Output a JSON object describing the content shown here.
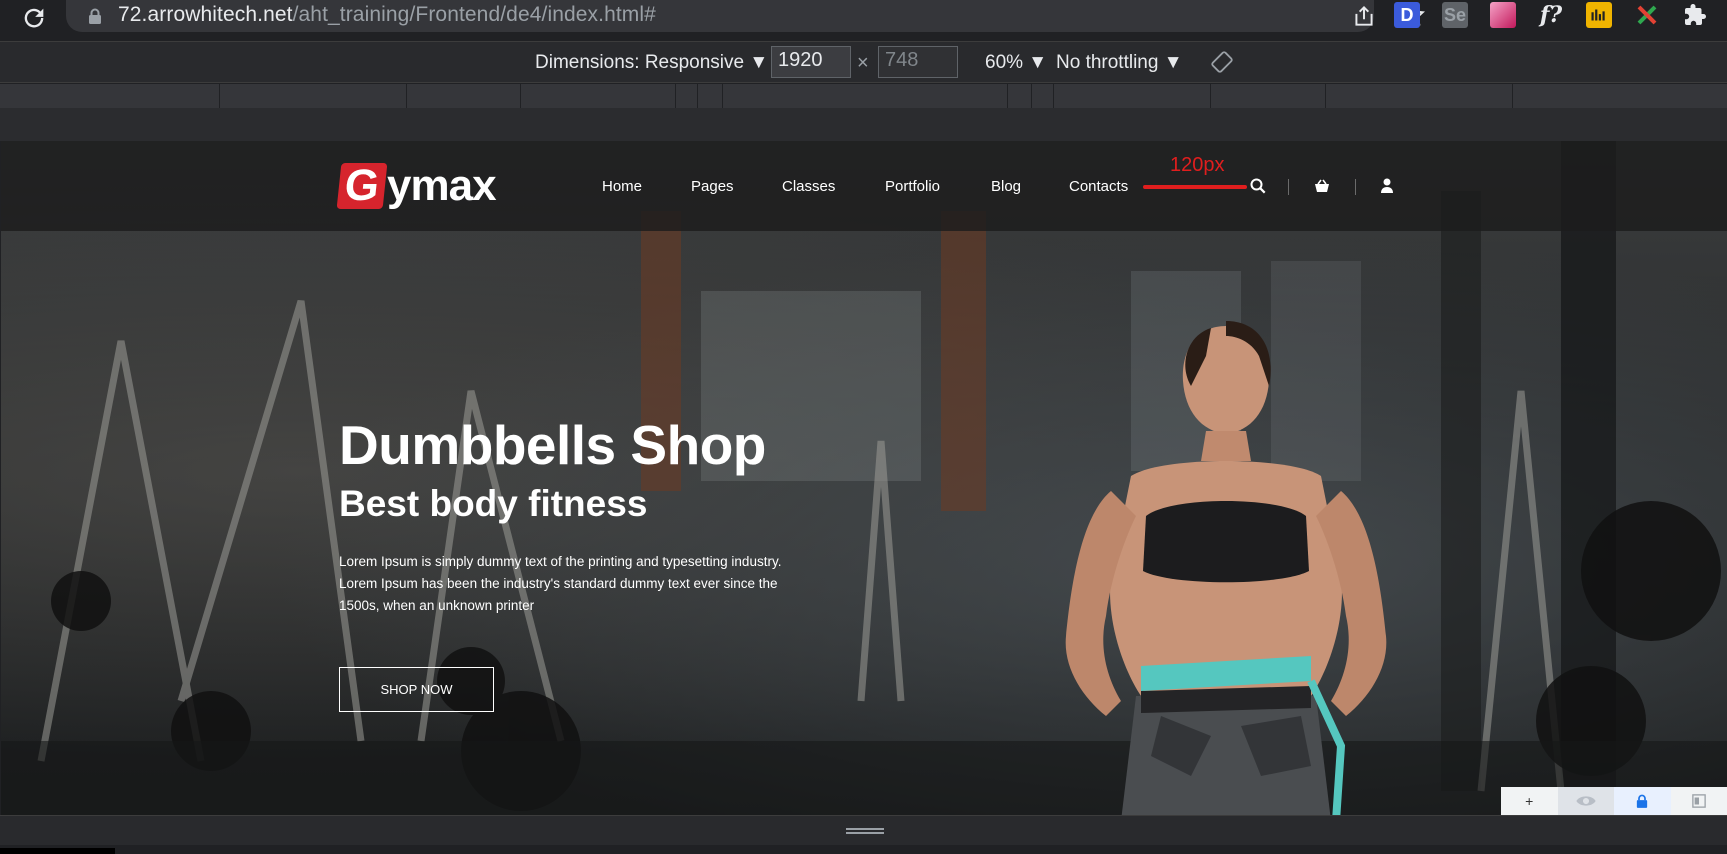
{
  "browser": {
    "url_domain": "72.arrowhitech.net",
    "url_path": "/aht_training/Frontend/de4/index.html#",
    "extensions": [
      {
        "name": "d-extension-icon",
        "letter": "D",
        "bg": "#3b5bdb",
        "color": "#ffffff"
      },
      {
        "name": "se-extension-icon",
        "letter": "Se",
        "bg": "#5f6368",
        "color": "#9aa0a6"
      },
      {
        "name": "gradient-extension-icon",
        "letter": "",
        "bg": "#e05fa6",
        "color": "#ffffff"
      },
      {
        "name": "fontface-extension-icon",
        "letter": "f?",
        "bg": "transparent",
        "color": "#e8eaed"
      },
      {
        "name": "chart-extension-icon",
        "letter": "",
        "bg": "#f0b400",
        "color": "#202124"
      },
      {
        "name": "tools-extension-icon",
        "letter": "",
        "bg": "transparent",
        "color": "#e8eaed"
      },
      {
        "name": "puzzle-extension-icon",
        "letter": "",
        "bg": "transparent",
        "color": "#e8eaed"
      }
    ]
  },
  "devtools": {
    "dimensions_label": "Dimensions: Responsive ▼",
    "width_value": "1920",
    "height_placeholder": "748",
    "times": "×",
    "zoom": "60% ▼",
    "throttling": "No throttling ▼"
  },
  "site": {
    "logo_letter": "G",
    "logo_rest": "ymax",
    "nav": [
      "Home",
      "Pages",
      "Classes",
      "Portfolio",
      "Blog",
      "Contacts"
    ],
    "annotation_label": "120px",
    "annotation_color": "#e01e1e",
    "hero": {
      "title": "Dumbbells Shop",
      "subtitle": "Best body fitness",
      "description": "Lorem Ipsum is simply dummy text of the printing and typesetting industry. Lorem Ipsum has been the industry's standard dummy text ever since the 1500s, when an unknown printer",
      "button": "SHOP NOW"
    }
  },
  "overlay_tools": [
    "+",
    "eye-icon",
    "lock-icon",
    "panel-icon"
  ]
}
